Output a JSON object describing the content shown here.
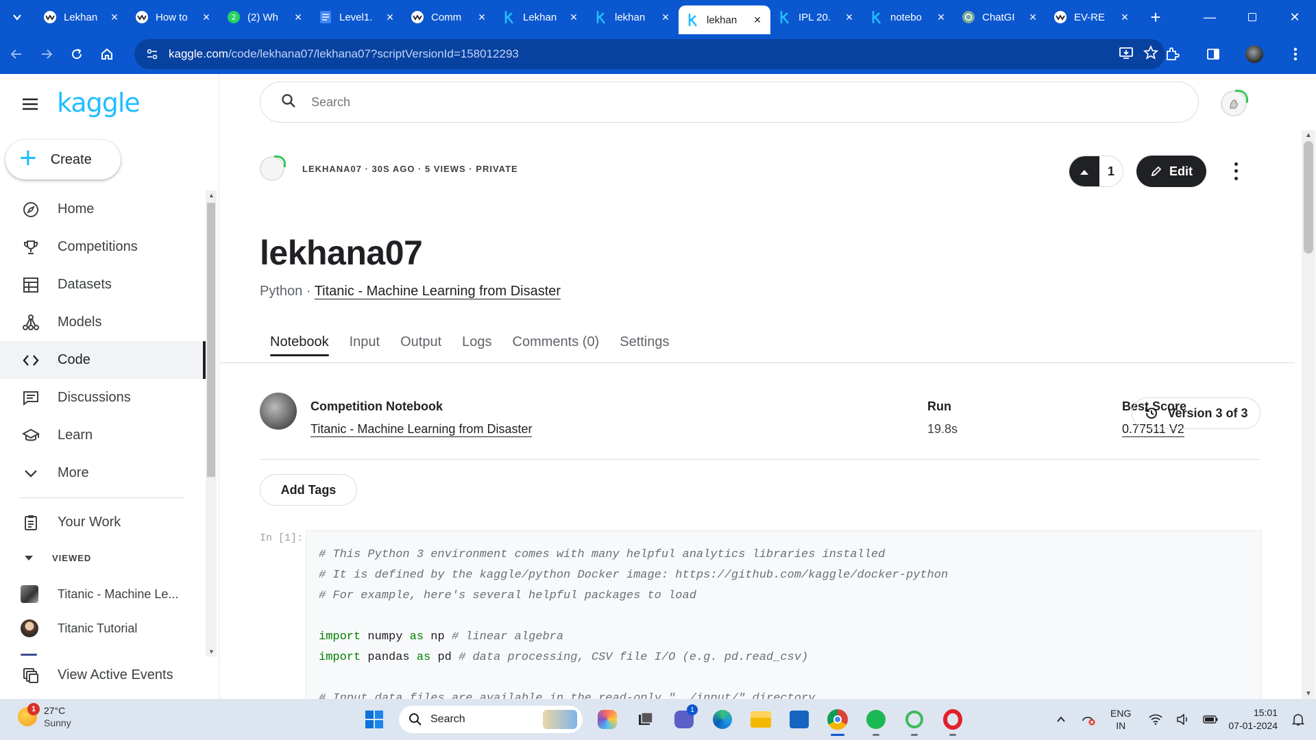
{
  "browser": {
    "tabs": [
      {
        "title": "Lekhan",
        "icon": "wave-icon",
        "active": false
      },
      {
        "title": "How to",
        "icon": "wave-icon",
        "active": false
      },
      {
        "title": "(2) Wh",
        "icon": "whatsapp-icon",
        "active": false
      },
      {
        "title": "Level1.",
        "icon": "docs-icon",
        "active": false
      },
      {
        "title": "Comm",
        "icon": "wave-icon",
        "active": false
      },
      {
        "title": "Lekhan",
        "icon": "kaggle-k-icon",
        "active": false
      },
      {
        "title": "lekhan",
        "icon": "kaggle-k-icon",
        "active": false
      },
      {
        "title": "lekhan",
        "icon": "kaggle-k-icon",
        "active": true
      },
      {
        "title": "IPL 20.",
        "icon": "kaggle-k-icon",
        "active": false
      },
      {
        "title": "notebo",
        "icon": "kaggle-k-icon",
        "active": false
      },
      {
        "title": "ChatGI",
        "icon": "chatgpt-icon",
        "active": false
      },
      {
        "title": "EV-RE",
        "icon": "wave-icon",
        "active": false
      }
    ],
    "url_host": "kaggle.com",
    "url_path": "/code/lekhana07/lekhana07?scriptVersionId=158012293",
    "accent": "#0b57d0"
  },
  "sidebar": {
    "logo": "kaggle",
    "create_label": "Create",
    "items": [
      {
        "label": "Home",
        "icon": "compass-icon"
      },
      {
        "label": "Competitions",
        "icon": "trophy-icon"
      },
      {
        "label": "Datasets",
        "icon": "table-icon"
      },
      {
        "label": "Models",
        "icon": "models-icon"
      },
      {
        "label": "Code",
        "icon": "code-icon",
        "active": true
      },
      {
        "label": "Discussions",
        "icon": "discussion-icon"
      },
      {
        "label": "Learn",
        "icon": "school-icon"
      },
      {
        "label": "More",
        "icon": "chevron-down-icon"
      }
    ],
    "your_work": "Your Work",
    "viewed_label": "VIEWED",
    "recent": [
      {
        "label": "Titanic - Machine Le..."
      },
      {
        "label": "Titanic Tutorial"
      }
    ],
    "active_events": "View Active Events"
  },
  "search": {
    "placeholder": "Search"
  },
  "notebook": {
    "meta": "LEKHANA07 · 30S AGO · 5 VIEWS · PRIVATE",
    "vote_count": "1",
    "edit_label": "Edit",
    "title": "lekhana07",
    "language": "Python · ",
    "competition_link": "Titanic - Machine Learning from Disaster",
    "tabs": [
      "Notebook",
      "Input",
      "Output",
      "Logs",
      "Comments (0)",
      "Settings"
    ],
    "competition_heading": "Competition Notebook",
    "competition_name": "Titanic - Machine Learning from Disaster",
    "run_heading": "Run",
    "run_value": "19.8s",
    "score_heading": "Best Score",
    "score_value": "0.77511 V2",
    "version_label": "Version 3 of 3",
    "add_tags": "Add Tags",
    "cell_label": "In [1]:",
    "code": [
      "# This Python 3 environment comes with many helpful analytics libraries installed",
      "# It is defined by the kaggle/python Docker image: https://github.com/kaggle/docker-python",
      "# For example, here's several helpful packages to load",
      "",
      "import numpy as np # linear algebra",
      "import pandas as pd # data processing, CSV file I/O (e.g. pd.read_csv)",
      "",
      "# Input data files are available in the read-only \"../input/\" directory"
    ]
  },
  "taskbar": {
    "temperature": "27°C",
    "weather": "Sunny",
    "notif_count": "1",
    "search_label": "Search",
    "lang1": "ENG",
    "lang2": "IN",
    "time": "15:01",
    "date": "07-01-2024"
  }
}
